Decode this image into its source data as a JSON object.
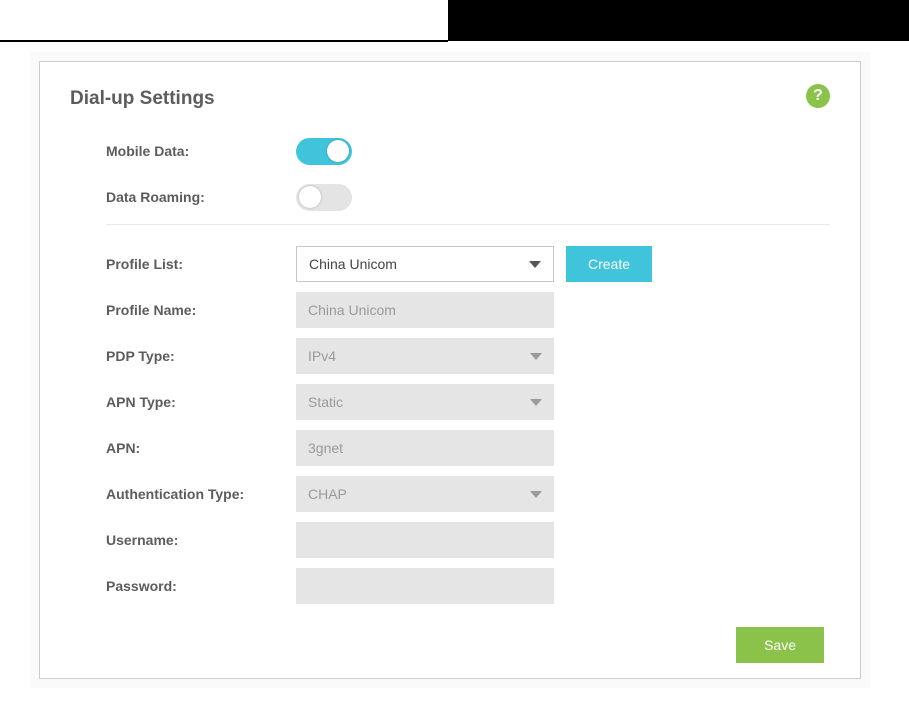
{
  "title": "Dial-up Settings",
  "help_icon": "?",
  "toggles": {
    "mobile_data": {
      "label": "Mobile Data:",
      "on": true
    },
    "data_roaming": {
      "label": "Data Roaming:",
      "on": false
    }
  },
  "fields": {
    "profile_list": {
      "label": "Profile List:",
      "value": "China Unicom"
    },
    "profile_name": {
      "label": "Profile Name:",
      "value": "China Unicom"
    },
    "pdp_type": {
      "label": "PDP Type:",
      "value": "IPv4"
    },
    "apn_type": {
      "label": "APN Type:",
      "value": "Static"
    },
    "apn": {
      "label": "APN:",
      "value": "3gnet"
    },
    "auth_type": {
      "label": "Authentication Type:",
      "value": "CHAP"
    },
    "username": {
      "label": "Username:",
      "value": ""
    },
    "password": {
      "label": "Password:",
      "value": ""
    }
  },
  "buttons": {
    "create": "Create",
    "save": "Save"
  }
}
